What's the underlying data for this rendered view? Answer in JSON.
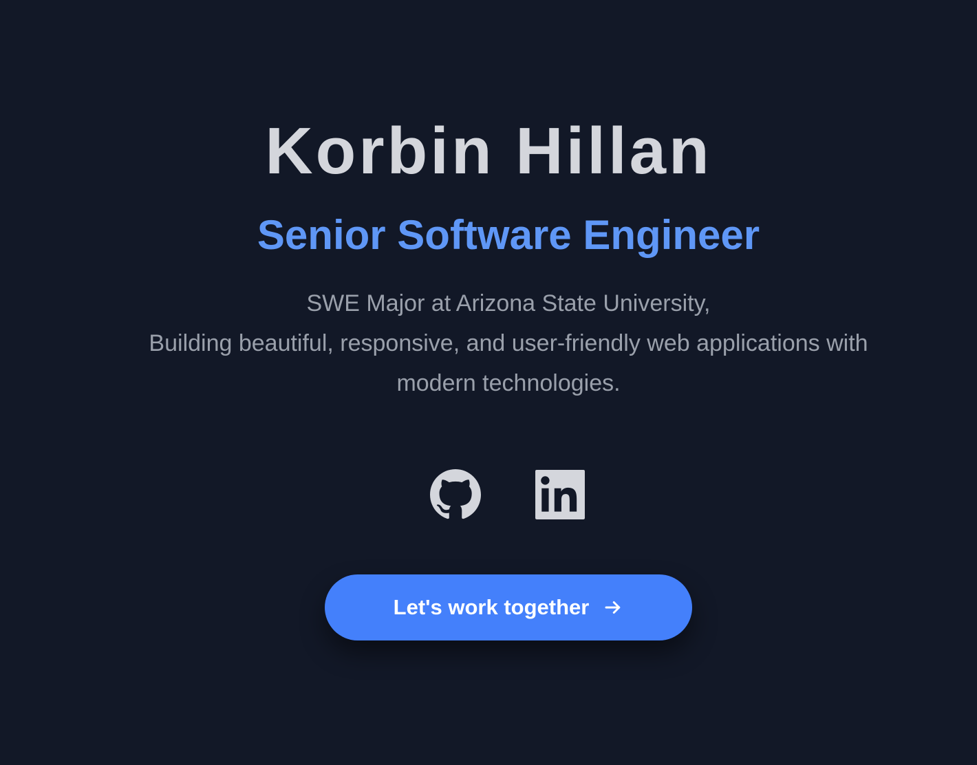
{
  "hero": {
    "name": "Korbin Hillan",
    "role": "Senior Software Engineer",
    "bio_line_1": "SWE Major at Arizona State University,",
    "bio_line_2": "Building beautiful, responsive, and user-friendly web applications with modern technologies."
  },
  "socials": [
    {
      "name": "GitHub",
      "icon": "github-icon"
    },
    {
      "name": "LinkedIn",
      "icon": "linkedin-icon"
    }
  ],
  "cta": {
    "label": "Let's work together",
    "icon": "arrow-right-icon"
  },
  "colors": {
    "background": "#121827",
    "name": "#d4d6dc",
    "accent": "#5f97f6",
    "bio": "#9aa0ab",
    "button": "#4480fb",
    "icon": "#d4d6dc"
  }
}
